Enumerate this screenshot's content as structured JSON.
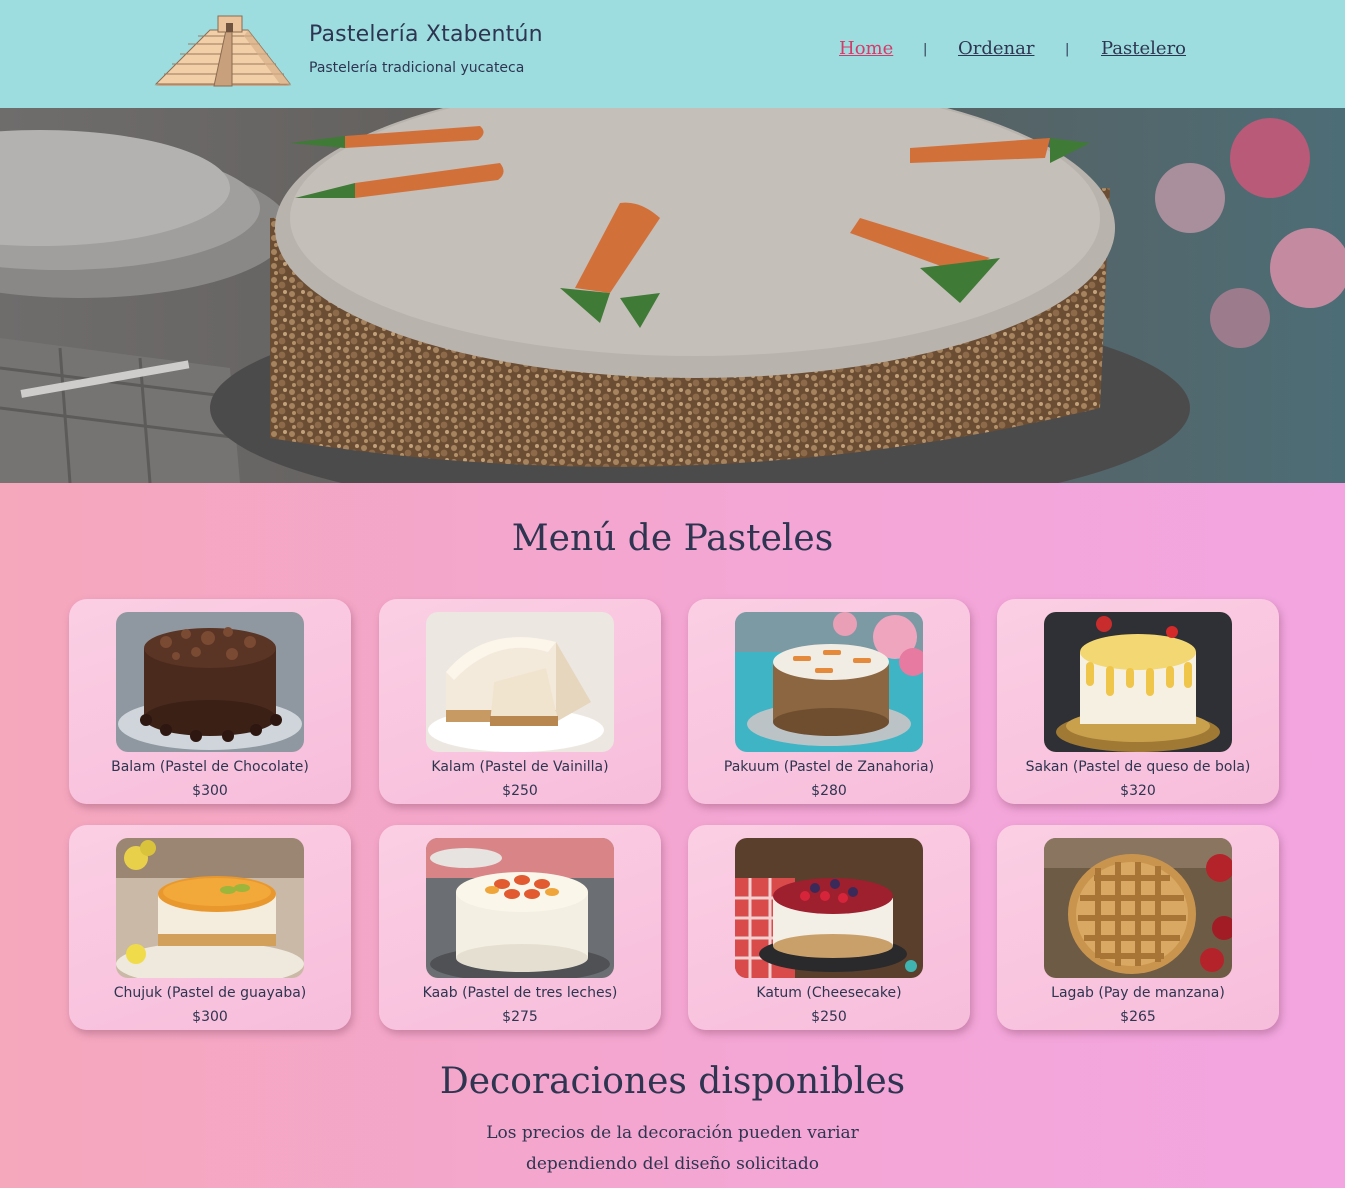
{
  "header": {
    "title": "Pastelería Xtabentún",
    "subtitle": "Pastelería tradicional yucateca",
    "nav": [
      {
        "label": "Home",
        "active": true
      },
      {
        "label": "Ordenar",
        "active": false
      },
      {
        "label": "Pastelero",
        "active": false
      }
    ],
    "separator": "|"
  },
  "menu": {
    "title": "Menú de Pasteles",
    "items": [
      {
        "name": "Balam (Pastel de Chocolate)",
        "price": "$300",
        "image": "chocolate-cake"
      },
      {
        "name": "Kalam (Pastel de Vainilla)",
        "price": "$250",
        "image": "vanilla-cheesecake"
      },
      {
        "name": "Pakuum (Pastel de Zanahoria)",
        "price": "$280",
        "image": "carrot-cake"
      },
      {
        "name": "Sakan (Pastel de queso de bola)",
        "price": "$320",
        "image": "cheese-ball-cake"
      },
      {
        "name": "Chujuk (Pastel de guayaba)",
        "price": "$300",
        "image": "guava-cake"
      },
      {
        "name": "Kaab (Pastel de tres leches)",
        "price": "$275",
        "image": "tres-leches-cake"
      },
      {
        "name": "Katum (Cheesecake)",
        "price": "$250",
        "image": "berry-cheesecake"
      },
      {
        "name": "Lagab (Pay de manzana)",
        "price": "$265",
        "image": "apple-pie"
      }
    ]
  },
  "decorations": {
    "title": "Decoraciones disponibles",
    "line1": "Los precios de la decoración pueden variar",
    "line2": "dependiendo del diseño solicitado"
  },
  "colors": {
    "header_bg": "#9ddde0",
    "active_link": "#d43b6a",
    "text": "#2e3550",
    "card_bg": "#f9c6df"
  }
}
